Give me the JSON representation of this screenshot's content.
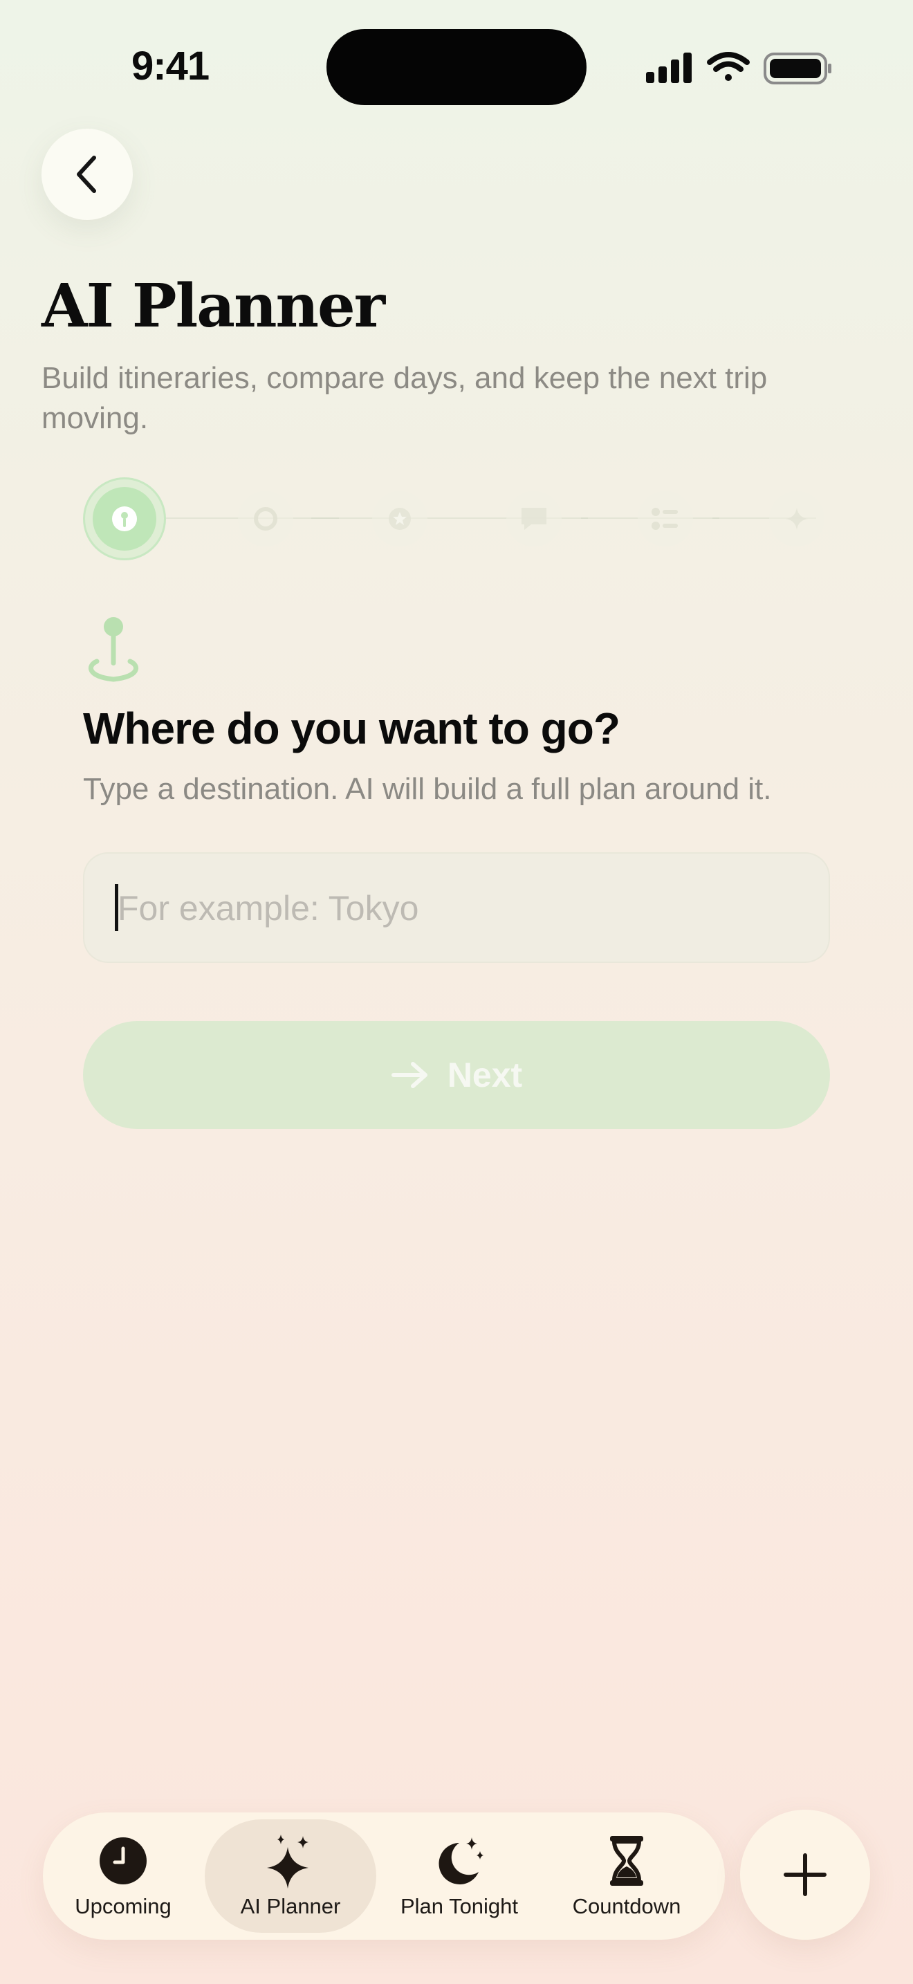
{
  "status_bar": {
    "time": "9:41"
  },
  "header": {
    "back_icon": "chevron-left-icon",
    "title": "AI Planner",
    "subtitle": "Build itineraries, compare days, and keep the next trip moving."
  },
  "stepper": {
    "current_step": 1,
    "steps": [
      {
        "icon": "location-pin-icon",
        "state": "active"
      },
      {
        "icon": "sun-icon",
        "state": "inactive"
      },
      {
        "icon": "star-icon",
        "state": "inactive"
      },
      {
        "icon": "chat-bubble-icon",
        "state": "inactive"
      },
      {
        "icon": "checklist-icon",
        "state": "inactive"
      },
      {
        "icon": "sparkle-icon",
        "state": "inactive"
      }
    ]
  },
  "step_content": {
    "icon": "map-pin-icon",
    "question": "Where do you want to go?",
    "helper": "Type a destination. AI will build a full plan around it.",
    "destination_input": {
      "value": "",
      "placeholder": "For example: Tokyo"
    },
    "next_button": {
      "label": "Next",
      "icon": "arrow-right-icon",
      "enabled": false
    }
  },
  "tab_bar": {
    "selected": "AI Planner",
    "tabs": [
      {
        "label": "Upcoming",
        "icon": "clock-icon"
      },
      {
        "label": "AI Planner",
        "icon": "sparkles-icon"
      },
      {
        "label": "Plan Tonight",
        "icon": "moon-stars-icon"
      },
      {
        "label": "Countdown",
        "icon": "hourglass-icon"
      }
    ],
    "add_button_icon": "plus-icon"
  },
  "colors": {
    "accent_green": "#bfe6b8",
    "disabled_button": "#dcead0",
    "tab_bar_bg": "#fdf4e6",
    "tab_selected_bg": "#efe3d4"
  }
}
